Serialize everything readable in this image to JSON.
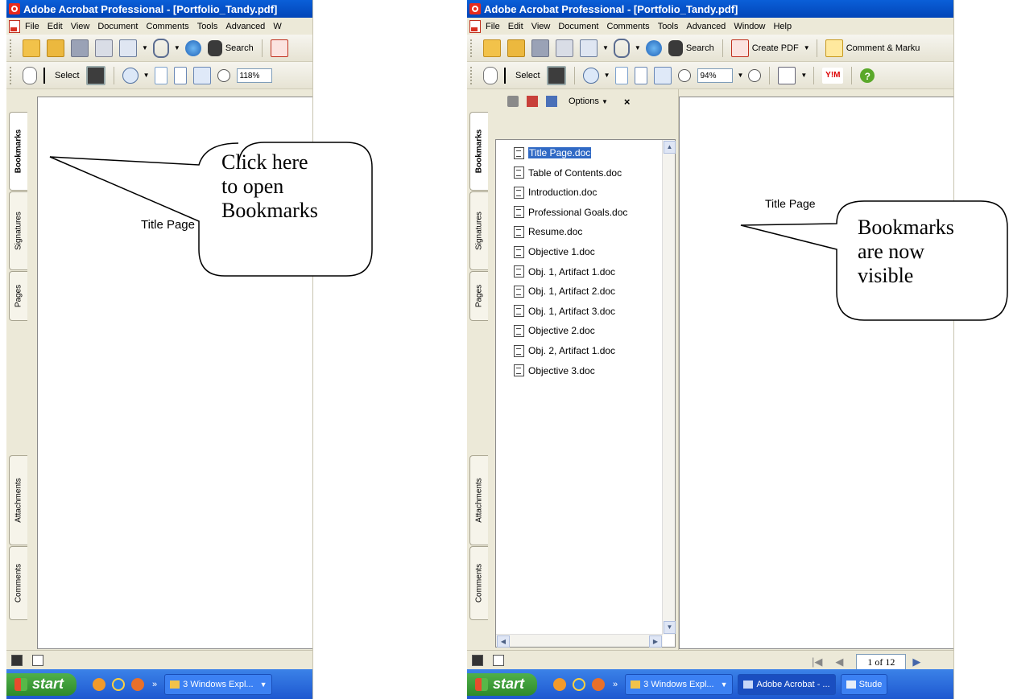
{
  "left": {
    "title": "Adobe Acrobat Professional - [Portfolio_Tandy.pdf]",
    "menu": [
      "File",
      "Edit",
      "View",
      "Document",
      "Comments",
      "Tools",
      "Advanced",
      "W"
    ],
    "toolbar1": {
      "search_label": "Search"
    },
    "toolbar2": {
      "select_label": "Select",
      "zoom_value": "118%"
    },
    "side_tabs": [
      "Bookmarks",
      "Signatures",
      "Pages",
      "Attachments",
      "Comments"
    ],
    "document_title": "Title Page",
    "taskbar": {
      "start": "start",
      "task1": "3 Windows Expl..."
    }
  },
  "right": {
    "title": "Adobe Acrobat Professional - [Portfolio_Tandy.pdf]",
    "menu": [
      "File",
      "Edit",
      "View",
      "Document",
      "Comments",
      "Tools",
      "Advanced",
      "Window",
      "Help"
    ],
    "toolbar1": {
      "search_label": "Search",
      "create_pdf_label": "Create PDF",
      "comment_label": "Comment & Marku"
    },
    "toolbar2": {
      "select_label": "Select",
      "zoom_value": "94%"
    },
    "side_tabs": [
      "Bookmarks",
      "Signatures",
      "Pages",
      "Attachments",
      "Comments"
    ],
    "bookmarks_panel": {
      "options_label": "Options",
      "close_label": "×",
      "items": [
        "Title Page.doc",
        "Table of Contents.doc",
        "Introduction.doc",
        "Professional Goals.doc",
        "Resume.doc",
        "Objective 1.doc",
        "Obj. 1, Artifact 1.doc",
        "Obj. 1, Artifact 2.doc",
        "Obj. 1, Artifact 3.doc",
        "Objective 2.doc",
        "Obj. 2, Artifact 1.doc",
        "Objective 3.doc"
      ],
      "selected_index": 0
    },
    "document_title": "Title Page",
    "page_indicator": "1 of 12",
    "taskbar": {
      "start": "start",
      "task1": "3 Windows Expl...",
      "task2": "Adobe Acrobat - ...",
      "task3": "Stude"
    }
  },
  "callouts": {
    "left_lines": [
      "Click here",
      "to open",
      "Bookmarks"
    ],
    "right_lines": [
      "Bookmarks",
      "are now",
      "visible"
    ]
  },
  "colors": {
    "titlebar": "#0a5fd8",
    "taskbar": "#2a68dc",
    "start": "#3a9a36",
    "selection": "#316ac5"
  }
}
